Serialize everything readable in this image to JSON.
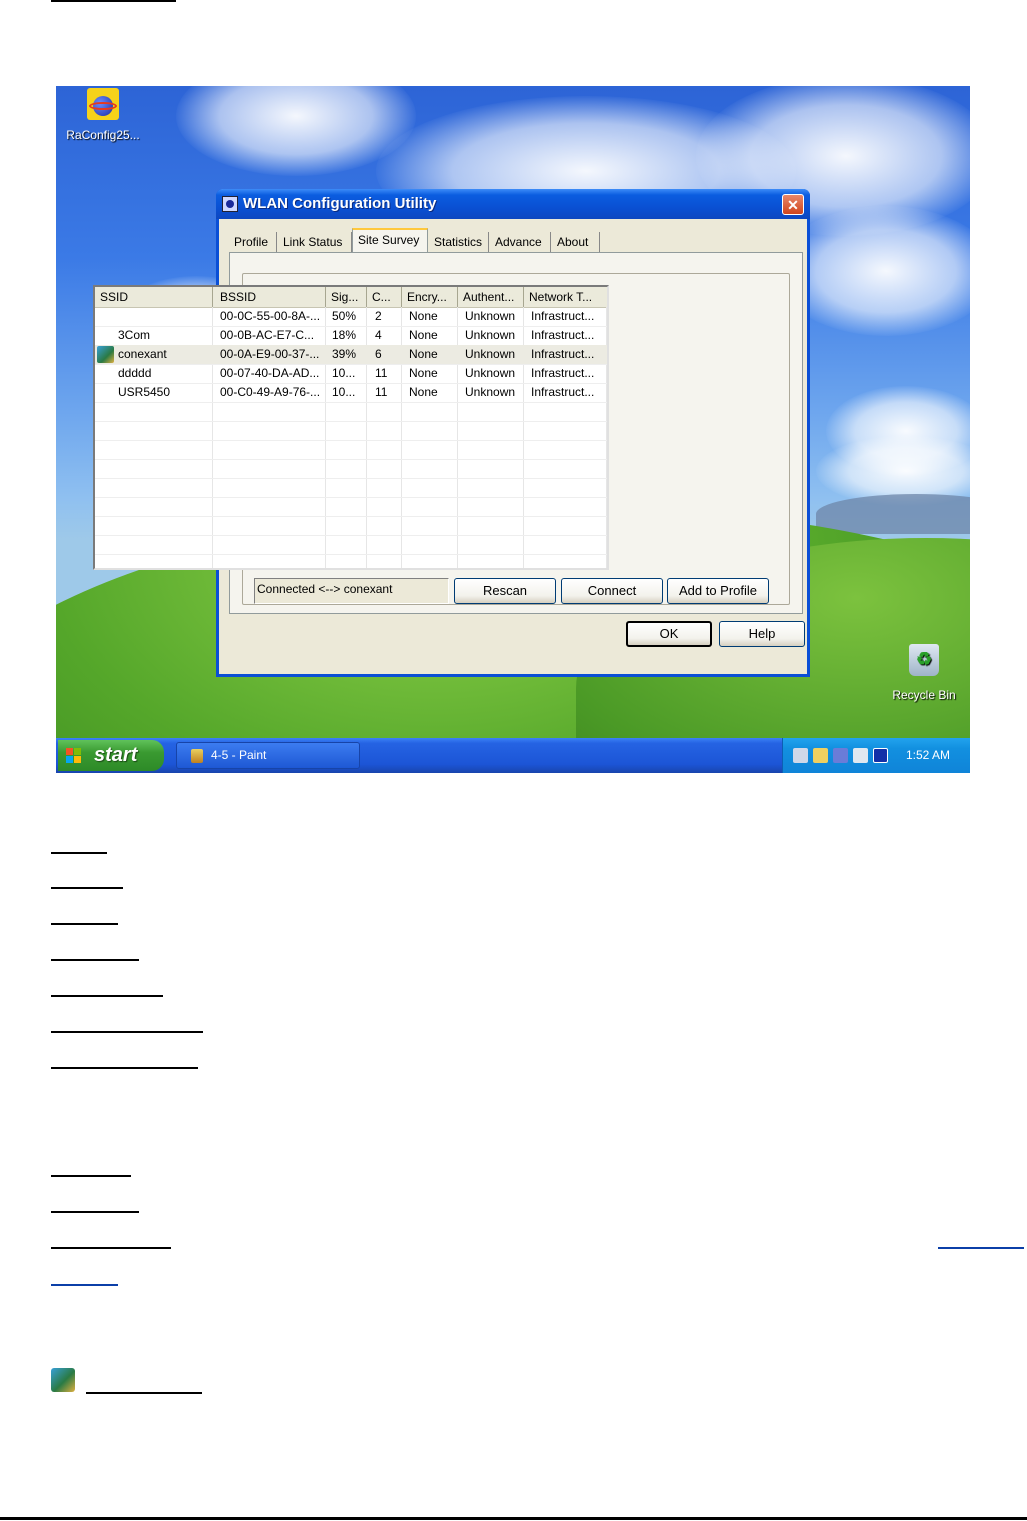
{
  "desktop": {
    "icon_raconfig_label": "RaConfig25...",
    "icon_recycle_label": "Recycle Bin"
  },
  "dialog": {
    "title": "WLAN Configuration Utility",
    "close_glyph": "✕",
    "tabs": [
      {
        "label": "Profile",
        "active": false
      },
      {
        "label": "Link Status",
        "active": false
      },
      {
        "label": "Site Survey",
        "active": true
      },
      {
        "label": "Statistics",
        "active": false
      },
      {
        "label": "Advance",
        "active": false
      },
      {
        "label": "About",
        "active": false
      }
    ],
    "table": {
      "columns": [
        "SSID",
        "BSSID",
        "Sig...",
        "C...",
        "Encry...",
        "Authent...",
        "Network T..."
      ],
      "rows": [
        {
          "ssid": "",
          "bssid": "00-0C-55-00-8A-...",
          "signal": "50%",
          "channel": "2",
          "encryption": "None",
          "auth": "Unknown",
          "network": "Infrastruct...",
          "connected": false
        },
        {
          "ssid": "3Com",
          "bssid": "00-0B-AC-E7-C...",
          "signal": "18%",
          "channel": "4",
          "encryption": "None",
          "auth": "Unknown",
          "network": "Infrastruct...",
          "connected": false
        },
        {
          "ssid": "conexant",
          "bssid": "00-0A-E9-00-37-...",
          "signal": "39%",
          "channel": "6",
          "encryption": "None",
          "auth": "Unknown",
          "network": "Infrastruct...",
          "connected": true
        },
        {
          "ssid": "ddddd",
          "bssid": "00-07-40-DA-AD...",
          "signal": "10...",
          "channel": "11",
          "encryption": "None",
          "auth": "Unknown",
          "network": "Infrastruct...",
          "connected": false
        },
        {
          "ssid": "USR5450",
          "bssid": "00-C0-49-A9-76-...",
          "signal": "10...",
          "channel": "11",
          "encryption": "None",
          "auth": "Unknown",
          "network": "Infrastruct...",
          "connected": false
        }
      ]
    },
    "status_text": "Connected <--> conexant",
    "buttons": {
      "rescan": "Rescan",
      "connect": "Connect",
      "add_profile": "Add to Profile",
      "ok": "OK",
      "help": "Help"
    }
  },
  "taskbar": {
    "start_label": "start",
    "task_label": "4-5 - Paint",
    "clock": "1:52 AM"
  },
  "colors": {
    "title_blue": "#0a4ed0",
    "start_green": "#3a9a31",
    "dialog_face": "#ece9d8"
  }
}
